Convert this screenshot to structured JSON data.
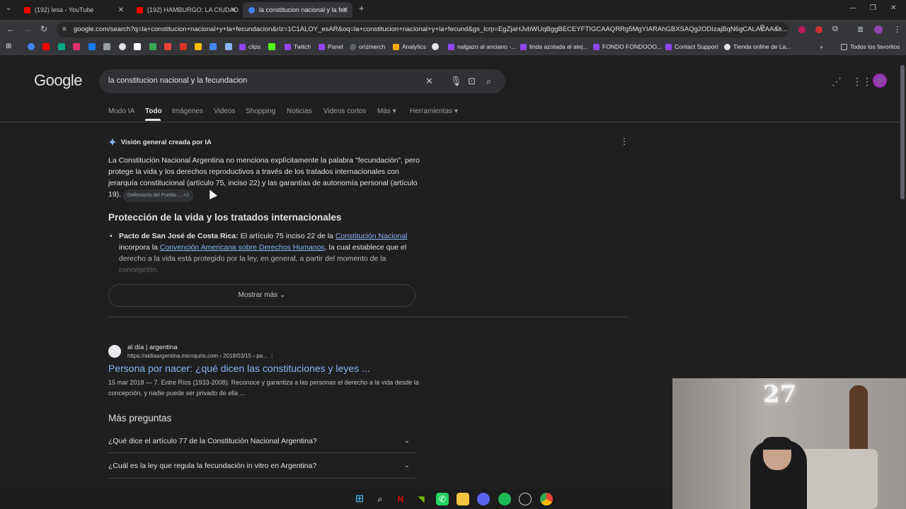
{
  "tabs": [
    {
      "title": "(192) lesa - YouTube",
      "favicon_color": "#ff0000"
    },
    {
      "title": "(192) HAMBURGO: LA CIUDAD",
      "favicon_color": "#ff0000"
    },
    {
      "title": "la constitucion nacional y la fec",
      "favicon_color": "#4285f4"
    }
  ],
  "new_tab_label": "+",
  "omnibox": {
    "url": "google.com/search?q=la+constitucion+nacional+y+la+fecundacion&rlz=1C1ALOY_esAR&oq=la+constitucion+nacional+y+la+fecund&gs_lcrp=EgZjaHJvbWUqBggBECEYFTIGCAAQRRg5MgYIARAhGBXSAQg2ODIzajBqN6gCALACAA&s..."
  },
  "bookmarks": [
    {
      "label": "clips"
    },
    {
      "label": "Twitch"
    },
    {
      "label": "Panel"
    },
    {
      "label": "orizmerch"
    },
    {
      "label": "Analytics"
    },
    {
      "label": "nalgazo al anciano -..."
    },
    {
      "label": "linda azotada al alej..."
    },
    {
      "label": "FONDO FONDOOO..."
    },
    {
      "label": "Contact Support"
    },
    {
      "label": "Tienda online de La..."
    },
    {
      "label": "Todos los favoritos"
    }
  ],
  "google": {
    "logo": "Google",
    "query": "la constitucion nacional y la fecundacion",
    "nav": [
      "Modo IA",
      "Todo",
      "Imágenes",
      "Videos",
      "Shopping",
      "Noticias",
      "Videos cortos",
      "Más",
      "Herramientas"
    ],
    "active_tab": "Todo",
    "ai_overview": {
      "title": "Visión general creada por IA",
      "text": "La Constitución Nacional Argentina no menciona explícitamente la palabra \"fecundación\", pero protege la vida y los derechos reproductivos a través de los tratados internacionales con jerarquía constitucional (artículo 75, inciso 22) y las garantías de autonomía personal (artículo 19).",
      "chip": "Defensoría del Pueblo ... +3",
      "heading": "Protección de la vida y los tratados internacionales",
      "bullet_bold": "Pacto de San José de Costa Rica:",
      "bullet_text_1": " El artículo 75 inciso 22 de la ",
      "bullet_link_1": "Constitución Nacional",
      "bullet_text_2": " incorpora la ",
      "bullet_link_2": "Convención Americana sobre Derechos Humanos",
      "bullet_text_3": ", la cual establece que el derecho a la vida está protegido por la ley, en general, a partir del momento de la concepción.",
      "show_more": "Mostrar más"
    },
    "result": {
      "site": "al día | argentina",
      "url": "https://aldiaargentina.microjuris.com › 2018/03/15 › pe...",
      "title": "Persona por nacer: ¿qué dicen las constituciones y leyes ...",
      "snippet": "15 mar 2018 — 7. Entre Ríos (1933-2008): Reconoce y garantiza a las personas el derecho a la vida desde la concepción, y nadie puede ser privado de ella ..."
    },
    "paa": {
      "heading": "Más preguntas",
      "questions": [
        "¿Qué dice el artículo 77 de la Constitución Nacional Argentina?",
        "¿Cuál es la ley que regula la fecundación in vitro en Argentina?"
      ]
    }
  },
  "webcam": {
    "sign": "27"
  }
}
